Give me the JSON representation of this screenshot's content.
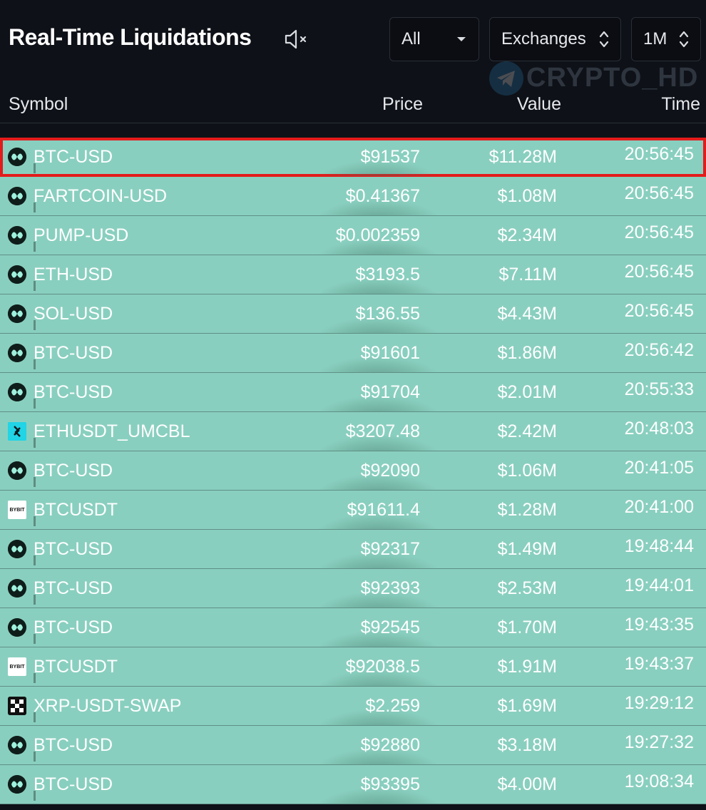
{
  "header": {
    "title": "Real-Time Liquidations",
    "filter_all": "All",
    "filter_exchanges": "Exchanges",
    "filter_timeframe": "1M",
    "watermark": "CRYPTO_HD"
  },
  "columns": {
    "symbol": "Symbol",
    "price": "Price",
    "value": "Value",
    "time": "Time"
  },
  "rows": [
    {
      "icon": "hyperliquid-icon",
      "symbol": "BTC-USD",
      "price": "$91537",
      "value": "$11.28M",
      "time": "20:56:45",
      "highlighted": true
    },
    {
      "icon": "hyperliquid-icon",
      "symbol": "FARTCOIN-USD",
      "price": "$0.41367",
      "value": "$1.08M",
      "time": "20:56:45"
    },
    {
      "icon": "hyperliquid-icon",
      "symbol": "PUMP-USD",
      "price": "$0.002359",
      "value": "$2.34M",
      "time": "20:56:45"
    },
    {
      "icon": "hyperliquid-icon",
      "symbol": "ETH-USD",
      "price": "$3193.5",
      "value": "$7.11M",
      "time": "20:56:45"
    },
    {
      "icon": "hyperliquid-icon",
      "symbol": "SOL-USD",
      "price": "$136.55",
      "value": "$4.43M",
      "time": "20:56:45"
    },
    {
      "icon": "hyperliquid-icon",
      "symbol": "BTC-USD",
      "price": "$91601",
      "value": "$1.86M",
      "time": "20:56:42"
    },
    {
      "icon": "hyperliquid-icon",
      "symbol": "BTC-USD",
      "price": "$91704",
      "value": "$2.01M",
      "time": "20:55:33"
    },
    {
      "icon": "bitget-icon",
      "symbol": "ETHUSDT_UMCBL",
      "price": "$3207.48",
      "value": "$2.42M",
      "time": "20:48:03"
    },
    {
      "icon": "hyperliquid-icon",
      "symbol": "BTC-USD",
      "price": "$92090",
      "value": "$1.06M",
      "time": "20:41:05"
    },
    {
      "icon": "bybit-icon",
      "symbol": "BTCUSDT",
      "price": "$91611.4",
      "value": "$1.28M",
      "time": "20:41:00"
    },
    {
      "icon": "hyperliquid-icon",
      "symbol": "BTC-USD",
      "price": "$92317",
      "value": "$1.49M",
      "time": "19:48:44"
    },
    {
      "icon": "hyperliquid-icon",
      "symbol": "BTC-USD",
      "price": "$92393",
      "value": "$2.53M",
      "time": "19:44:01"
    },
    {
      "icon": "hyperliquid-icon",
      "symbol": "BTC-USD",
      "price": "$92545",
      "value": "$1.70M",
      "time": "19:43:35"
    },
    {
      "icon": "bybit-icon",
      "symbol": "BTCUSDT",
      "price": "$92038.5",
      "value": "$1.91M",
      "time": "19:43:37"
    },
    {
      "icon": "okx-icon",
      "symbol": "XRP-USDT-SWAP",
      "price": "$2.259",
      "value": "$1.69M",
      "time": "19:29:12"
    },
    {
      "icon": "hyperliquid-icon",
      "symbol": "BTC-USD",
      "price": "$92880",
      "value": "$3.18M",
      "time": "19:27:32"
    },
    {
      "icon": "hyperliquid-icon",
      "symbol": "BTC-USD",
      "price": "$93395",
      "value": "$4.00M",
      "time": "19:08:34"
    }
  ],
  "colors": {
    "background": "#0e1117",
    "row_fill": "#89cfbf",
    "highlight": "#e31b1b",
    "text": "#ffffff"
  }
}
